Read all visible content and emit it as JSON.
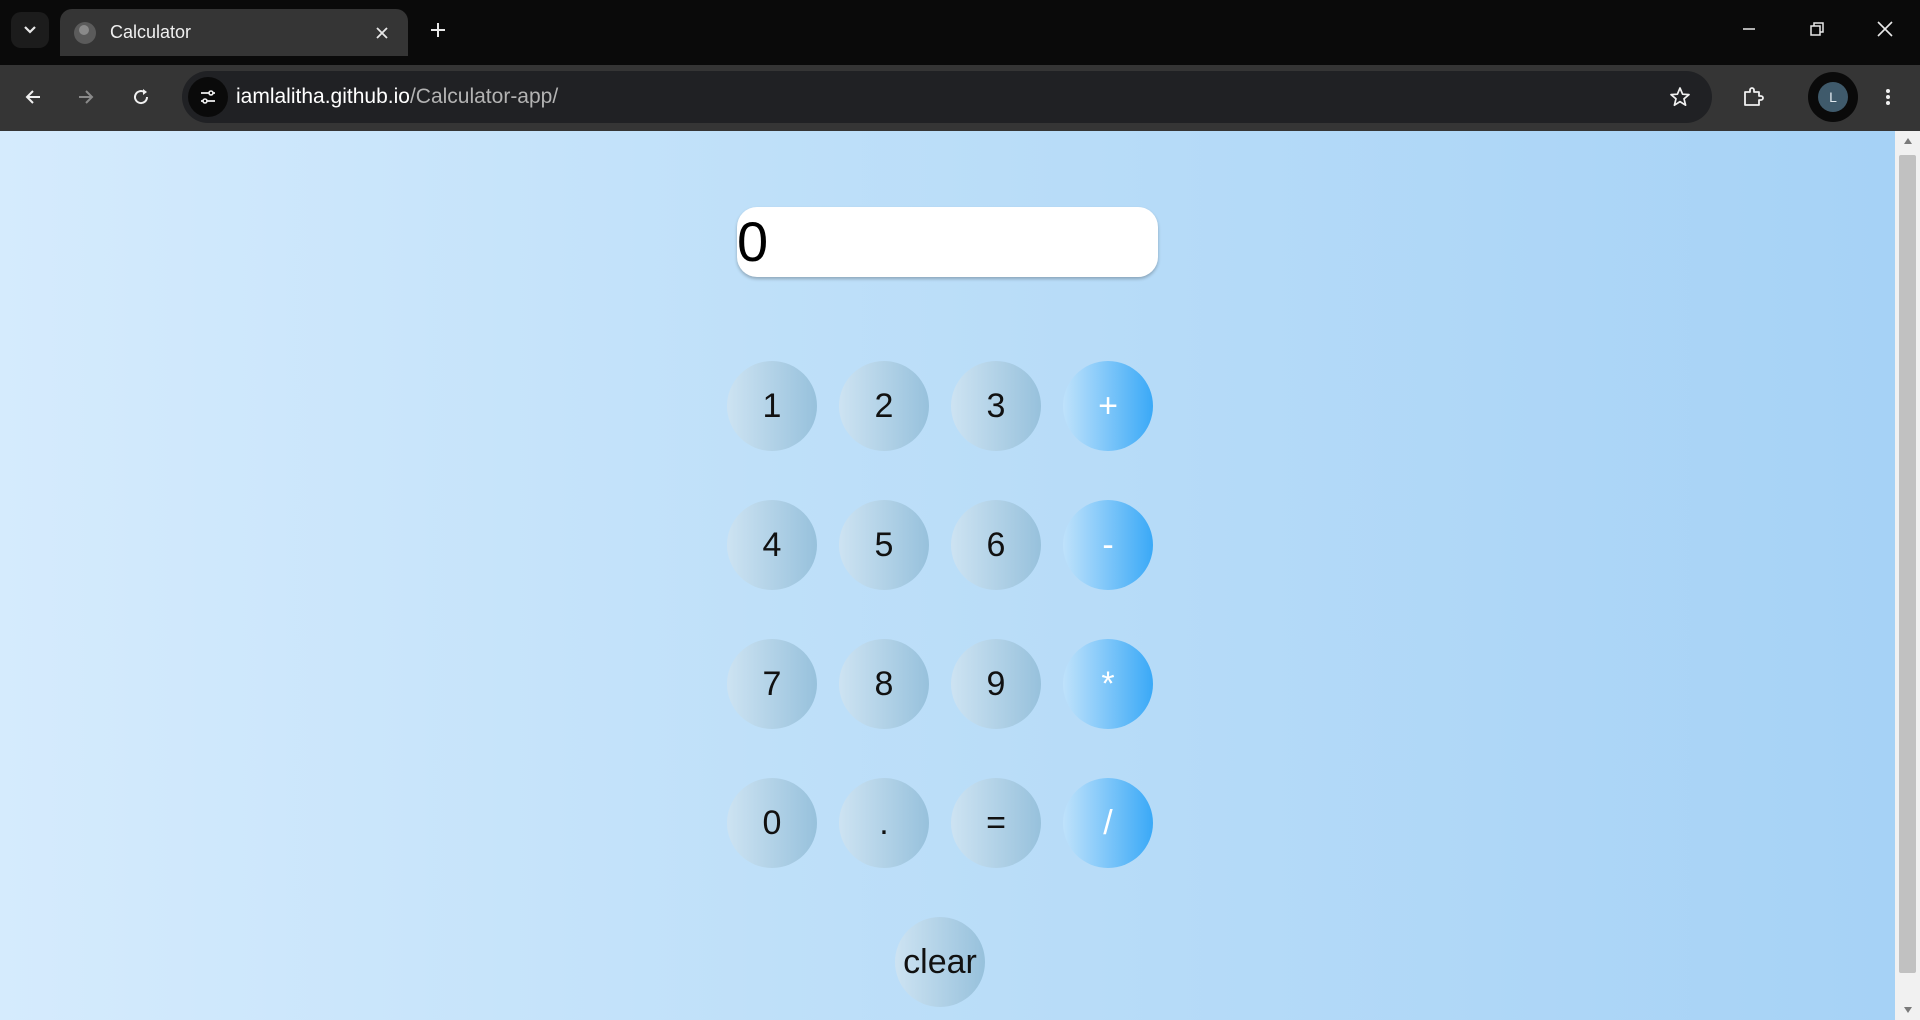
{
  "browser": {
    "tab_title": "Calculator",
    "url_host": "iamlalitha.github.io",
    "url_path": "/Calculator-app/",
    "profile_initial": "L"
  },
  "icons": {
    "tab_search": "chevron-down-icon",
    "favicon": "globe-icon",
    "tab_close": "close-icon",
    "new_tab": "plus-icon",
    "minimize": "minimize-icon",
    "restore": "restore-icon",
    "close_window": "close-icon",
    "back": "arrow-left-icon",
    "forward": "arrow-right-icon",
    "reload": "reload-icon",
    "site_info": "tune-icon",
    "bookmark": "star-icon",
    "extensions": "puzzle-icon",
    "menu": "more-vert-icon"
  },
  "calculator": {
    "display_value": "0",
    "rows": [
      [
        "1",
        "2",
        "3",
        "+"
      ],
      [
        "4",
        "5",
        "6",
        "-"
      ],
      [
        "7",
        "8",
        "9",
        "*"
      ],
      [
        "0",
        ".",
        "=",
        "/"
      ]
    ],
    "clear_label": "clear"
  },
  "colors": {
    "page_gradient_start": "#d5ebfd",
    "page_gradient_end": "#a6d2f6",
    "key_gradient_start": "#cde3f2",
    "key_gradient_end": "#97c1dc",
    "operator_gradient_end": "#3aa9f7"
  }
}
